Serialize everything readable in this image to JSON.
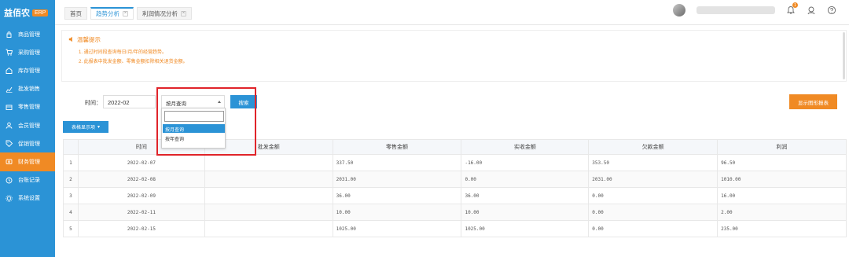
{
  "app": {
    "logo_text": "益佰农",
    "logo_badge": "ERP"
  },
  "sidebar": {
    "items": [
      {
        "label": "商品管理",
        "icon": "lock-icon"
      },
      {
        "label": "采购管理",
        "icon": "cart-icon"
      },
      {
        "label": "库存管理",
        "icon": "home-icon"
      },
      {
        "label": "批发销售",
        "icon": "chart-icon"
      },
      {
        "label": "零售管理",
        "icon": "register-icon"
      },
      {
        "label": "会员管理",
        "icon": "user-icon"
      },
      {
        "label": "促销管理",
        "icon": "tag-icon"
      },
      {
        "label": "财务管理",
        "icon": "wallet-icon",
        "active": true
      },
      {
        "label": "台账记录",
        "icon": "clock-icon"
      },
      {
        "label": "系统设置",
        "icon": "gear-icon"
      }
    ]
  },
  "tabs": [
    {
      "label": "首页",
      "closable": false
    },
    {
      "label": "趋势分析",
      "closable": true,
      "active": true
    },
    {
      "label": "利润情况分析",
      "closable": true
    }
  ],
  "header": {
    "notification_count": "1"
  },
  "notice": {
    "title": "温馨提示",
    "lines": [
      "1. 通过时间段查询每日/月/年的经营趋势。",
      "2. 此报表中批发金额、零售金额扣除相关退货金额。"
    ]
  },
  "filter": {
    "time_label": "时间：",
    "date_value": "2022-02",
    "select_value": "按月查询",
    "search_label": "搜索",
    "chart_button": "显示图形报表",
    "dropdown_options": [
      "按月查询",
      "按年查询"
    ],
    "dropdown_selected": 0
  },
  "table": {
    "column_toggle": "表格显示项",
    "headers": [
      "",
      "时间",
      "批发金额",
      "零售金额",
      "实收金额",
      "欠款金额",
      "利润"
    ],
    "rows": [
      [
        "1",
        "2022-02-07",
        "",
        "337.50",
        "-16.00",
        "353.50",
        "96.50"
      ],
      [
        "2",
        "2022-02-08",
        "",
        "2031.00",
        "0.00",
        "2031.00",
        "1010.00"
      ],
      [
        "3",
        "2022-02-09",
        "",
        "36.00",
        "36.00",
        "0.00",
        "16.00"
      ],
      [
        "4",
        "2022-02-11",
        "",
        "10.00",
        "10.00",
        "0.00",
        "2.00"
      ],
      [
        "5",
        "2022-02-15",
        "",
        "1025.00",
        "1025.00",
        "0.00",
        "235.00"
      ]
    ]
  },
  "colors": {
    "primary": "#2b93d6",
    "accent": "#f08a24",
    "highlight": "#e0242a"
  }
}
